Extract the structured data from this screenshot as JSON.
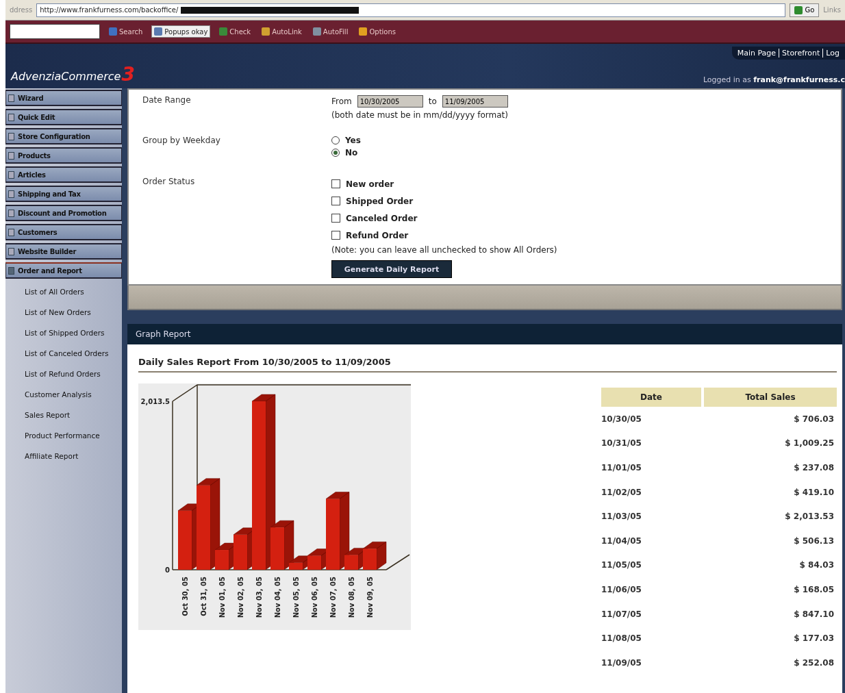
{
  "browser": {
    "address_label": "ddress",
    "url": "http://www.frankfurness.com/backoffice/",
    "go": "Go",
    "links": "Links",
    "toolbar": [
      {
        "kind": "search",
        "label": "Search"
      },
      {
        "kind": "popups",
        "label": "Popups okay"
      },
      {
        "kind": "check",
        "label": "Check"
      },
      {
        "kind": "autolink",
        "label": "AutoLink"
      },
      {
        "kind": "autofill",
        "label": "AutoFill"
      },
      {
        "kind": "options",
        "label": "Options"
      }
    ]
  },
  "header": {
    "logo": "AdvenziaCommerce",
    "logo_version": "3",
    "links": [
      "Main Page",
      "Storefront",
      "Log"
    ],
    "logged_in_prefix": "Logged in as",
    "user": "frank@frankfurness.c"
  },
  "sidebar": {
    "items": [
      {
        "label": "Wizard",
        "expanded": false
      },
      {
        "label": "Quick Edit",
        "expanded": false
      },
      {
        "label": "Store Configuration",
        "expanded": false
      },
      {
        "label": "Products",
        "expanded": false
      },
      {
        "label": "Articles",
        "expanded": false
      },
      {
        "label": "Shipping and Tax",
        "expanded": false
      },
      {
        "label": "Discount and Promotion",
        "expanded": false
      },
      {
        "label": "Customers",
        "expanded": false
      },
      {
        "label": "Website Builder",
        "expanded": false
      },
      {
        "label": "Order and Report",
        "expanded": true,
        "children": [
          "List of All Orders",
          "List of New Orders",
          "List of Shipped Orders",
          "List of Canceled Orders",
          "List of Refund Orders",
          "Customer Analysis",
          "Sales Report",
          "Product Performance",
          "Affiliate Report"
        ]
      }
    ]
  },
  "form": {
    "date_range": {
      "label": "Date Range",
      "from_label": "From",
      "from": "10/30/2005",
      "to_label": "to",
      "to": "11/09/2005",
      "hint": "(both date must be in mm/dd/yyyy format)"
    },
    "group_by_weekday": {
      "label": "Group by Weekday",
      "options": [
        {
          "label": "Yes",
          "selected": false
        },
        {
          "label": "No",
          "selected": true
        }
      ]
    },
    "order_status": {
      "label": "Order Status",
      "options": [
        {
          "label": "New order",
          "checked": false
        },
        {
          "label": "Shipped Order",
          "checked": false
        },
        {
          "label": "Canceled Order",
          "checked": false
        },
        {
          "label": "Refund Order",
          "checked": false
        }
      ],
      "note": "(Note: you can leave all unchecked to show All Orders)"
    },
    "button": "Generate Daily Report"
  },
  "graph_report": {
    "title": "Graph Report",
    "report_title": "Daily Sales Report From 10/30/2005 to 11/09/2005",
    "chart_data": {
      "type": "bar",
      "categories": [
        "Oct 30, 05",
        "Oct 31, 05",
        "Nov 01, 05",
        "Nov 02, 05",
        "Nov 03, 05",
        "Nov 04, 05",
        "Nov 05, 05",
        "Nov 06, 05",
        "Nov 07, 05",
        "Nov 08, 05",
        "Nov 09, 05"
      ],
      "series": [
        {
          "color": "#d42010",
          "values": [
            706,
            1009,
            237,
            419,
            2014,
            506,
            84,
            168,
            847,
            177,
            252
          ]
        }
      ],
      "ylim": [
        0,
        2014
      ],
      "yticks": [
        0,
        {
          "value": 2013.5,
          "label": "2,013.5"
        }
      ]
    },
    "table": {
      "columns": [
        "Date",
        "Total Sales"
      ],
      "rows": [
        [
          "10/30/05",
          "$ 706.03"
        ],
        [
          "10/31/05",
          "$ 1,009.25"
        ],
        [
          "11/01/05",
          "$ 237.08"
        ],
        [
          "11/02/05",
          "$ 419.10"
        ],
        [
          "11/03/05",
          "$ 2,013.53"
        ],
        [
          "11/04/05",
          "$ 506.13"
        ],
        [
          "11/05/05",
          "$ 84.03"
        ],
        [
          "11/06/05",
          "$ 168.05"
        ],
        [
          "11/07/05",
          "$ 847.10"
        ],
        [
          "11/08/05",
          "$ 177.03"
        ],
        [
          "11/09/05",
          "$ 252.08"
        ]
      ]
    }
  }
}
